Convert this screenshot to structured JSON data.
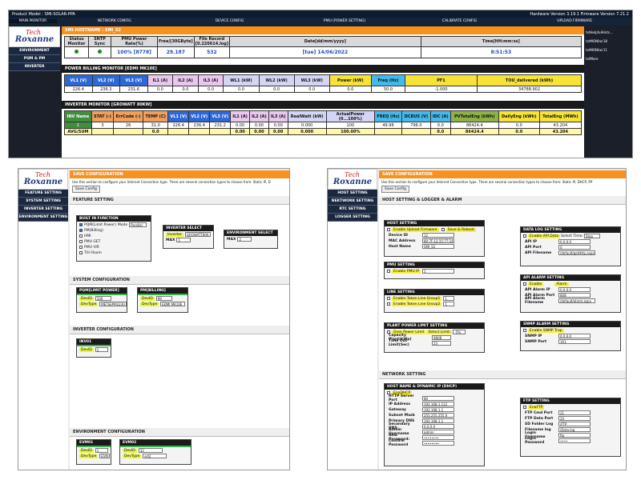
{
  "main": {
    "top_left": "Product Model : SMI-SOLAR-PPA",
    "top_right": "Hardware Version 3.19.1    Firmware Version 7.21.2",
    "nav": [
      "MAIN MONITOR",
      "NETWORK CONFIG",
      "DEVICE CONFIG",
      "PMU (POWER SETTING)",
      "CALIBRATE CONFIG",
      "UPLOAD FIRMWARE"
    ],
    "sidebar": [
      "ENVIRONMENT",
      "PQM & PM",
      "INVERTER"
    ],
    "side_links": [
      "txtHelpfulHints...",
      "txtMONitor18",
      "txtMONitor11",
      "txtMore"
    ],
    "logo_t": "Tech",
    "logo_r": "Roxanne",
    "hostname_bar": "SMI-HOSTNAME : SMI_S2",
    "status_headers": [
      "Status Monitor",
      "SNTP Sync",
      "PMU Power Rate(%)",
      "Free/[30GByte]",
      "File Record [0.220614.log]",
      "Date[dd/mm/yyyy]",
      "Time[HH:mm:ss]"
    ],
    "status_values": [
      "",
      "",
      "100% [8778]",
      "29.187",
      "532",
      "[tue] 14/06/2022",
      "8:51:53"
    ],
    "billing_title": "POWER BILLING MONITOR [EDMI MK10E]",
    "billing_headers": [
      "VL1 (V)",
      "VL2 (V)",
      "VL3 (V)",
      "IL1 (A)",
      "IL2 (A)",
      "IL3 (A)",
      "WL1 (kW)",
      "WL2 (kW)",
      "WL3 (kW)",
      "Power (kW)",
      "Freq (Hz)",
      "PF1",
      "TOU_delivered (kWh)"
    ],
    "billing_values": [
      "226.4",
      "236.3",
      "231.6",
      "0.0",
      "0.0",
      "0.0",
      "0.0",
      "0.0",
      "0.0",
      "0.0",
      "50.0",
      "-1.000",
      "34788.902"
    ],
    "inverter_title": "INVERTER MONITOR [GROWATT 80KW]",
    "inverter_headers": [
      "INV Name",
      "STAT (-)",
      "ErrCode (-)",
      "TEMP (C)",
      "VL1 (V)",
      "VL2 (V)",
      "VL3 (V)",
      "IL1 (A)",
      "IL2 (A)",
      "IL3 (A)",
      "RealWatt (kW)",
      "ActualPower (0...100%)",
      "FREQ (Hz)",
      "DCBUS (V)",
      "IDC (A)",
      "PVTotalEng (kWh)",
      "DailyEng (kWh)",
      "TotalEng (MWh)"
    ],
    "inverter_row": [
      "1",
      "3",
      "26",
      "31.0",
      "226.4",
      "236.4",
      "231.2",
      "0.00",
      "0.00",
      "0.00",
      "0.000",
      "100",
      "49.96",
      "796.0",
      "0.0",
      "86424.4",
      "0.0",
      "43.204"
    ],
    "inverter_sum": [
      "AVG/SUM",
      "",
      "",
      "0.0",
      "",
      "",
      "",
      "0.00",
      "0.00",
      "0.00",
      "0.000",
      "100.00%",
      "",
      "",
      "0.0",
      "86424.4",
      "0.0",
      "43.204"
    ]
  },
  "left": {
    "logo_t": "Tech",
    "logo_r": "Roxanne",
    "sidebar": [
      "FEATURE SETTING",
      "SYSTEM SETTING",
      "INVERTER SETTING",
      "ENVIRONMENT SETTING"
    ],
    "save_title": "SAVE CONFIGURATION",
    "save_desc": "Use this section to configure your Internet Connection type. There are several connection types to choose from: Static IP, D",
    "save_btn": "Save Config",
    "feature_title": "FEATURE SETTING",
    "builtin_title": "BUILT IN FUNCTION",
    "builtin_items": [
      "PQM(Limit Power)",
      "PM(Billing)",
      "HMI",
      "PMU GET",
      "PMU VIR",
      "T/H Room"
    ],
    "mode_label": "Mode",
    "mode_value": "Parallel",
    "inv_select_title": "INVERTER SELECT",
    "inv_select_label": "Inverter",
    "inv_select_value": "GROWATT80K",
    "max_label": "MAX",
    "inv_max_value": "1",
    "env_select_title": "ENVIRONMENT SELECT",
    "env_max_value": "2",
    "system_title": "SYSTEM CONFIGURATION",
    "pqm_title": "PQM[LIMIT POWER]",
    "pm_title": "PM[BILLING]",
    "devid_label": "DevID",
    "devtype_label": "DevType",
    "pqm_devid": "100",
    "pqm_devtype": "METSEPM2230",
    "pm_devid": "99",
    "pm_devtype": "EDMI MK10E",
    "inverter_cfg_title": "INVERTER CONFIGURATION",
    "inv01_title": "INV01",
    "inv01_devid": "1",
    "env_cfg_title": "ENVIRONMENT CONFIGURATION",
    "evm01_title": "EVM01",
    "evm02_title": "EVM02",
    "evm01_devid": "1",
    "evm01_devtype": "EVM",
    "evm02_devid": "32",
    "evm02_devtype": "ert2"
  },
  "right": {
    "logo_t": "Tech",
    "logo_r": "Roxanne",
    "sidebar": [
      "HOST SETTING",
      "NEKTWORK SETTING",
      "RTC SETTING",
      "LOGGER SETTING"
    ],
    "save_title": "SAVE CONFIGURATION",
    "save_desc": "Use this section to configure your Internet Connection type. There are several connection types to choose from: Static IP, DHCP, PP",
    "save_btn": "Save Config",
    "host_logger_title": "HOST SETTING & LOGGER & ALARM",
    "host_title": "HOST SETTING",
    "enable_upload": "Enable Upload Firmware",
    "save_reboot": "Save & Reboot",
    "device_id_label": "Device ID",
    "device_id": "12",
    "mac_label": "MAC Address",
    "mac": "80:7F:12:15:77:14",
    "hostname_label": "Host Name",
    "hostname": "SMI_S2",
    "pmu_title": "PMU SETTING",
    "enable_pmu": "Enable PMU IP",
    "pmu_ip": "1",
    "line_title": "LINE SETTING",
    "token1": "Enable Token Line Group1",
    "token1_val": "1",
    "token2": "Enable Token Line Group2",
    "token2_val": "1",
    "plant_title": "PLANT POWER LIMIT SETTING",
    "over_power": "Over Power Limit",
    "select_limit": "Select Limit:",
    "select_limit_val": "-5%",
    "capacity_label": "Capacity Plant(kWp)",
    "capacity_val": "9808",
    "timeout_label": "Time Out Limit(Sec)",
    "timeout_val": "23",
    "datalog_title": "DATA LOG SETTING",
    "enable_api": "Enable API Data",
    "select_time": "Select Time:",
    "select_time_val": "Stop",
    "api_ip_label": "API IP",
    "api_ip": "0.0.0.0",
    "api_port_label": "API Port",
    "api_port": "0",
    "api_file_label": "API Filename",
    "api_file": "/default/getHttp.aspx",
    "alarm_title": "API ALARM SETTING",
    "enable_alarm": "Enable",
    "alarm_word": "Alarm",
    "alarm_ip_label": "API Alarm IP",
    "alarm_ip": "0.0.0.0",
    "alarm_port_label": "API Alarm Port",
    "alarm_port": "808",
    "alarm_file_label": "API Alarm Filename",
    "alarm_file": "/default/alarm.aspx",
    "snmp_title": "SNMP ALARM SETTING",
    "enable_snmp": "Enable SNMP Trap",
    "snmp_ip_label": "SNMP IP",
    "snmp_ip": "0.0.0.0",
    "snmp_port_label": "SNMP Port",
    "snmp_port": "161",
    "network_title": "NETWORK SETTING",
    "dhcp_title": "HOST NAME & DYNAMIC IP (DHCP)",
    "ena_dhcp": "EnaDHCP",
    "net_fields": [
      {
        "label": "HTTP Server Port",
        "value": "80"
      },
      {
        "label": "IP Address",
        "value": "192.168.1.112"
      },
      {
        "label": "Gateway",
        "value": "192.168.1.1"
      },
      {
        "label": "Subnet Mask",
        "value": "255.255.255.0"
      },
      {
        "label": "Primary DNS",
        "value": "192.168.1.1"
      },
      {
        "label": "Secondary DNS",
        "value": "0.0.0.0"
      },
      {
        "label": "Admin Username",
        "value": "admin"
      },
      {
        "label": "New Password:",
        "value": "••••••••"
      },
      {
        "label": "Confirm Password",
        "value": "••••••••"
      }
    ],
    "ftp_title": "FTP SETTING",
    "ena_ftp": "EnaFTP",
    "ftp_fields": [
      {
        "label": "FTP Cmd Port",
        "value": "21"
      },
      {
        "label": "FTP Data Port",
        "value": "20"
      },
      {
        "label": "SD Folder Log",
        "value": "/FTP"
      },
      {
        "label": "Filename log",
        "value": "/Data.log"
      },
      {
        "label": "Login Username",
        "value": "ftp"
      },
      {
        "label": "Login Password",
        "value": "••••"
      }
    ]
  }
}
